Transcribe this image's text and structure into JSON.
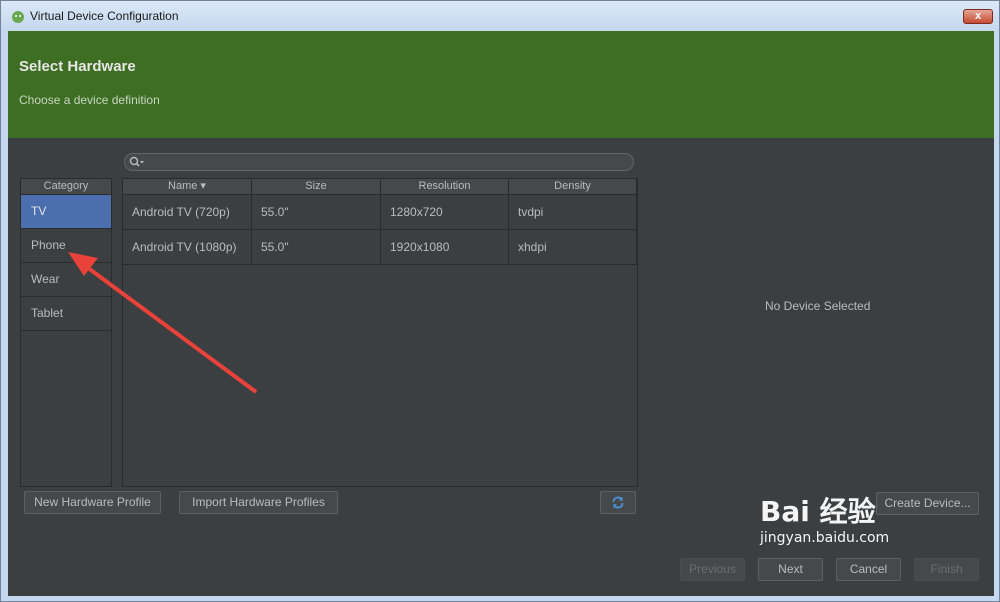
{
  "window": {
    "title": "Virtual Device Configuration",
    "close_label": "x"
  },
  "header": {
    "title": "Select Hardware",
    "subtitle": "Choose a device definition"
  },
  "search": {
    "value": ""
  },
  "category": {
    "header": "Category",
    "items": [
      {
        "label": "TV",
        "selected": true
      },
      {
        "label": "Phone"
      },
      {
        "label": "Wear"
      },
      {
        "label": "Tablet"
      }
    ]
  },
  "table": {
    "columns": [
      "Name ▾",
      "Size",
      "Resolution",
      "Density"
    ],
    "rows": [
      {
        "name": "Android TV (720p)",
        "size": "55.0\"",
        "resolution": "1280x720",
        "density": "tvdpi"
      },
      {
        "name": "Android TV (1080p)",
        "size": "55.0\"",
        "resolution": "1920x1080",
        "density": "xhdpi"
      }
    ]
  },
  "detail": {
    "empty_text": "No Device Selected"
  },
  "buttons": {
    "new_profile": "New Hardware Profile",
    "import_profiles": "Import Hardware Profiles",
    "create_device": "Create Device...",
    "previous": "Previous",
    "next": "Next",
    "cancel": "Cancel",
    "finish": "Finish"
  },
  "icons": {
    "search": "search-icon",
    "refresh": "refresh-icon",
    "app": "android-studio-icon"
  },
  "watermark": {
    "brand": "Bai 经验",
    "domain": "jingyan.baidu.com"
  },
  "colors": {
    "header_bg": "#3d6e23",
    "selected": "#4b6eaf",
    "arrow": "#e8423a"
  }
}
